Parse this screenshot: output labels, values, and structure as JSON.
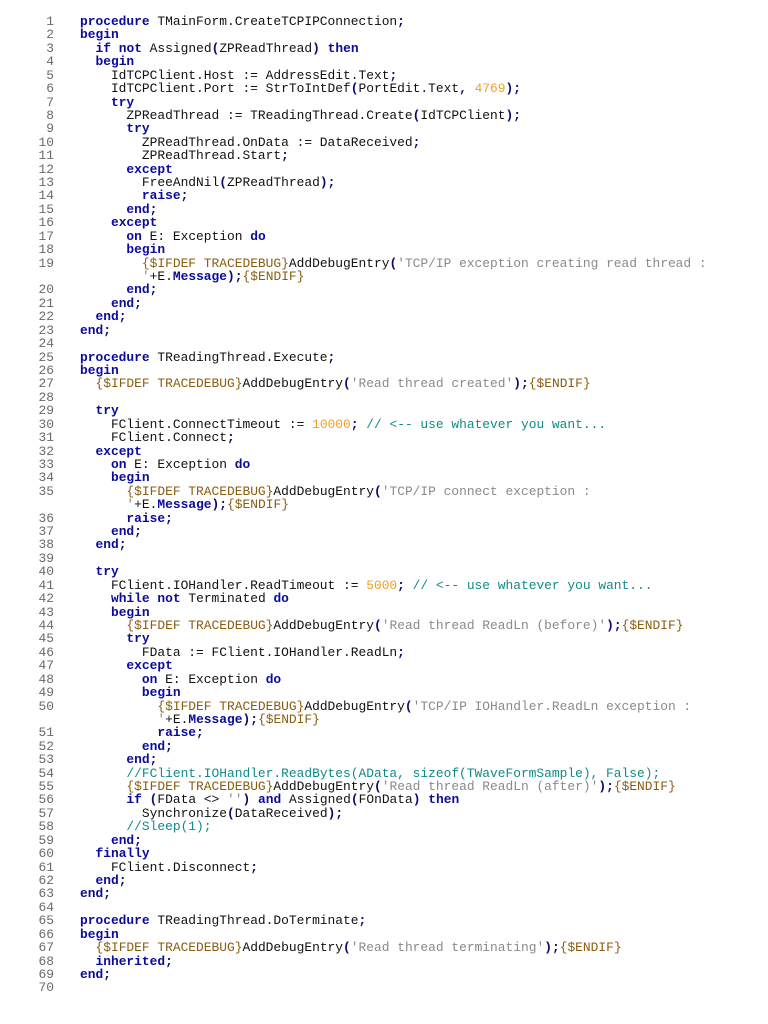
{
  "lines": [
    {
      "n": "1",
      "text": "procedure TMainForm.CreateTCPIPConnection;"
    },
    {
      "n": "2",
      "text": "begin"
    },
    {
      "n": "3",
      "text": "  if not Assigned(ZPReadThread) then"
    },
    {
      "n": "4",
      "text": "  begin"
    },
    {
      "n": "5",
      "text": "    IdTCPClient.Host := AddressEdit.Text;"
    },
    {
      "n": "6",
      "text": "    IdTCPClient.Port := StrToIntDef(PortEdit.Text, 4769);"
    },
    {
      "n": "7",
      "text": "    try"
    },
    {
      "n": "8",
      "text": "      ZPReadThread := TReadingThread.Create(IdTCPClient);"
    },
    {
      "n": "9",
      "text": "      try"
    },
    {
      "n": "10",
      "text": "        ZPReadThread.OnData := DataReceived;"
    },
    {
      "n": "11",
      "text": "        ZPReadThread.Start;"
    },
    {
      "n": "12",
      "text": "      except"
    },
    {
      "n": "13",
      "text": "        FreeAndNil(ZPReadThread);"
    },
    {
      "n": "14",
      "text": "        raise;"
    },
    {
      "n": "15",
      "text": "      end;"
    },
    {
      "n": "16",
      "text": "    except"
    },
    {
      "n": "17",
      "text": "      on E: Exception do"
    },
    {
      "n": "18",
      "text": "      begin"
    },
    {
      "n": "19",
      "text": "        {$IFDEF TRACEDEBUG}AddDebugEntry('TCP/IP exception creating read thread :"
    },
    {
      "n": "",
      "text": "        '+E.Message);{$ENDIF}"
    },
    {
      "n": "20",
      "text": "      end;"
    },
    {
      "n": "21",
      "text": "    end;"
    },
    {
      "n": "22",
      "text": "  end;"
    },
    {
      "n": "23",
      "text": "end;"
    },
    {
      "n": "24",
      "text": ""
    },
    {
      "n": "25",
      "text": "procedure TReadingThread.Execute;"
    },
    {
      "n": "26",
      "text": "begin"
    },
    {
      "n": "27",
      "text": "  {$IFDEF TRACEDEBUG}AddDebugEntry('Read thread created');{$ENDIF}"
    },
    {
      "n": "28",
      "text": ""
    },
    {
      "n": "29",
      "text": "  try"
    },
    {
      "n": "30",
      "text": "    FClient.ConnectTimeout := 10000; // <-- use whatever you want..."
    },
    {
      "n": "31",
      "text": "    FClient.Connect;"
    },
    {
      "n": "32",
      "text": "  except"
    },
    {
      "n": "33",
      "text": "    on E: Exception do"
    },
    {
      "n": "34",
      "text": "    begin"
    },
    {
      "n": "35",
      "text": "      {$IFDEF TRACEDEBUG}AddDebugEntry('TCP/IP connect exception :"
    },
    {
      "n": "",
      "text": "      '+E.Message);{$ENDIF}"
    },
    {
      "n": "36",
      "text": "      raise;"
    },
    {
      "n": "37",
      "text": "    end;"
    },
    {
      "n": "38",
      "text": "  end;"
    },
    {
      "n": "39",
      "text": ""
    },
    {
      "n": "40",
      "text": "  try"
    },
    {
      "n": "41",
      "text": "    FClient.IOHandler.ReadTimeout := 5000; // <-- use whatever you want..."
    },
    {
      "n": "42",
      "text": "    while not Terminated do"
    },
    {
      "n": "43",
      "text": "    begin"
    },
    {
      "n": "44",
      "text": "      {$IFDEF TRACEDEBUG}AddDebugEntry('Read thread ReadLn (before)');{$ENDIF}"
    },
    {
      "n": "45",
      "text": "      try"
    },
    {
      "n": "46",
      "text": "        FData := FClient.IOHandler.ReadLn;"
    },
    {
      "n": "47",
      "text": "      except"
    },
    {
      "n": "48",
      "text": "        on E: Exception do"
    },
    {
      "n": "49",
      "text": "        begin"
    },
    {
      "n": "50",
      "text": "          {$IFDEF TRACEDEBUG}AddDebugEntry('TCP/IP IOHandler.ReadLn exception :"
    },
    {
      "n": "",
      "text": "          '+E.Message);{$ENDIF}"
    },
    {
      "n": "51",
      "text": "          raise;"
    },
    {
      "n": "52",
      "text": "        end;"
    },
    {
      "n": "53",
      "text": "      end;"
    },
    {
      "n": "54",
      "text": "      //FClient.IOHandler.ReadBytes(AData, sizeof(TWaveFormSample), False);"
    },
    {
      "n": "55",
      "text": "      {$IFDEF TRACEDEBUG}AddDebugEntry('Read thread ReadLn (after)');{$ENDIF}"
    },
    {
      "n": "56",
      "text": "      if (FData <> '') and Assigned(FOnData) then"
    },
    {
      "n": "57",
      "text": "        Synchronize(DataReceived);"
    },
    {
      "n": "58",
      "text": "      //Sleep(1);"
    },
    {
      "n": "59",
      "text": "    end;"
    },
    {
      "n": "60",
      "text": "  finally"
    },
    {
      "n": "61",
      "text": "    FClient.Disconnect;"
    },
    {
      "n": "62",
      "text": "  end;"
    },
    {
      "n": "63",
      "text": "end;"
    },
    {
      "n": "64",
      "text": ""
    },
    {
      "n": "65",
      "text": "procedure TReadingThread.DoTerminate;"
    },
    {
      "n": "66",
      "text": "begin"
    },
    {
      "n": "67",
      "text": "  {$IFDEF TRACEDEBUG}AddDebugEntry('Read thread terminating');{$ENDIF}"
    },
    {
      "n": "68",
      "text": "  inherited;"
    },
    {
      "n": "69",
      "text": "end;"
    },
    {
      "n": "70",
      "text": ""
    }
  ],
  "colors": {
    "keyword": "#0a0a9c",
    "string": "#8a8a8a",
    "number": "#f0a020",
    "comment": "#108a8a",
    "directive": "#8a5c10",
    "line_number": "#6a6a6a"
  }
}
